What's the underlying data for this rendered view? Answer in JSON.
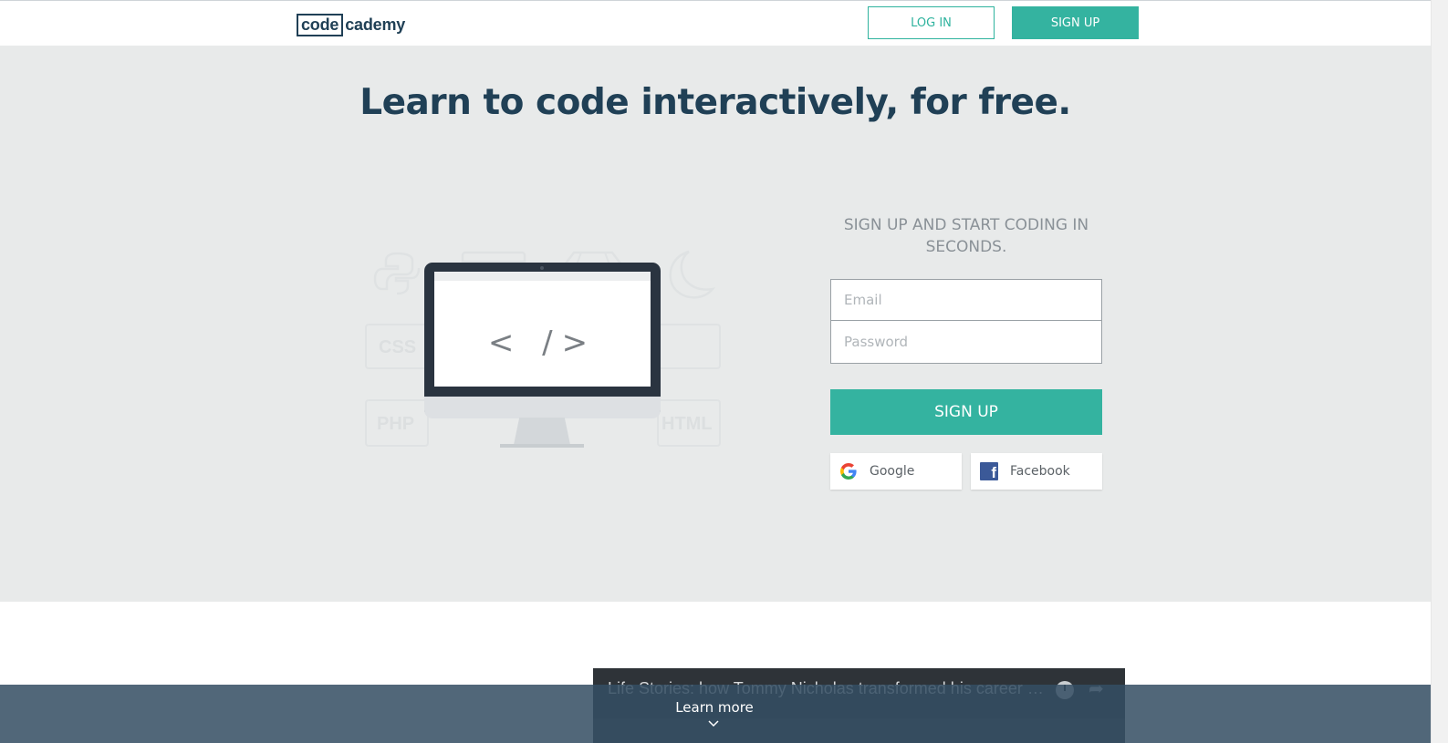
{
  "header": {
    "logo_box": "code",
    "logo_rest": "cademy",
    "login_label": "LOG IN",
    "signup_label": "SIGN UP"
  },
  "hero": {
    "headline": "Learn to code interactively, for free.",
    "illustration": {
      "code_glyph": "< />",
      "ghost_labels": [
        "CSS",
        "PHP",
        "HTML"
      ]
    },
    "form": {
      "heading": "SIGN UP AND START CODING IN SECONDS.",
      "email_placeholder": "Email",
      "password_placeholder": "Password",
      "signup_label": "SIGN UP",
      "google_label": "Google",
      "facebook_label": "Facebook"
    }
  },
  "video": {
    "title": "Life Stories: how Tommy Nicholas transformed his career wi..."
  },
  "footer_bar": {
    "learn_more": "Learn more"
  },
  "colors": {
    "brand_navy": "#204056",
    "accent_teal": "#34b3a0",
    "hero_bg": "#e8eaea",
    "facebook_blue": "#3b5998"
  },
  "icons": [
    "python-icon",
    "webpage-icon",
    "ruby-gem-icon",
    "moon-icon",
    "google-icon",
    "facebook-icon",
    "clock-icon",
    "share-icon",
    "chevron-down-icon"
  ]
}
